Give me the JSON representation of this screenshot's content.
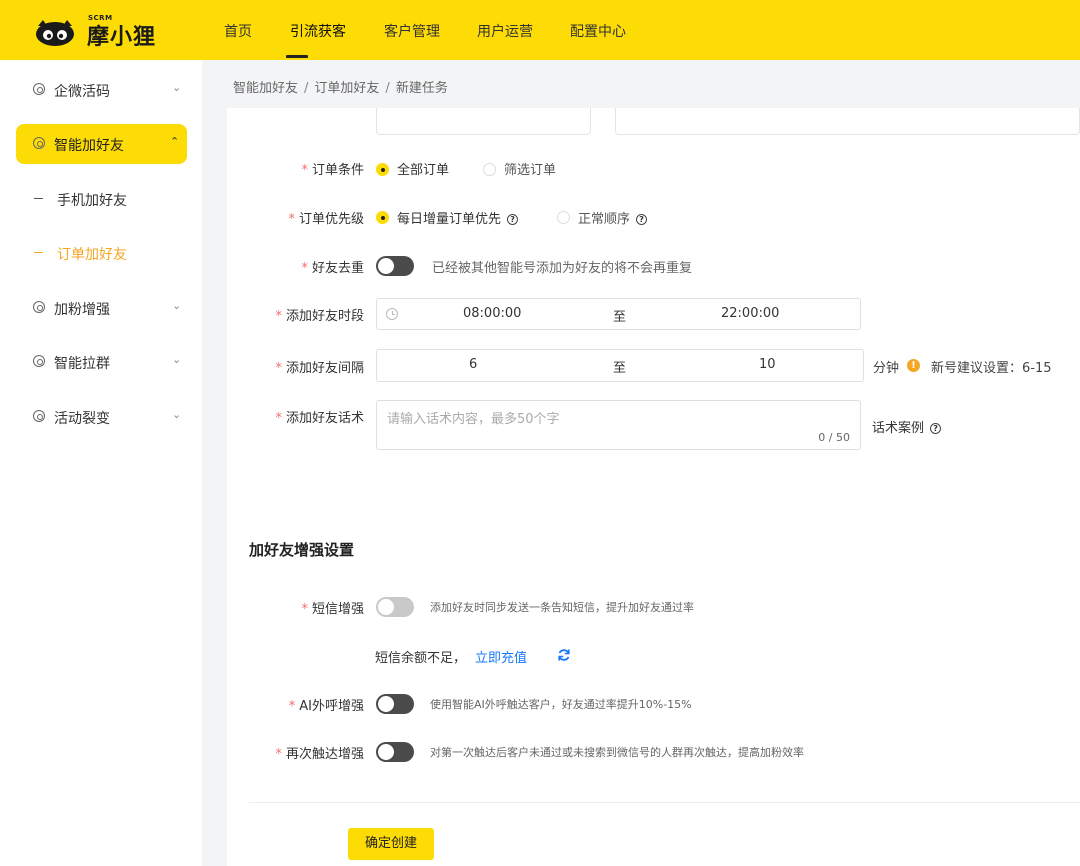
{
  "brand": {
    "scrm": "SCRM",
    "name": "摩小狸"
  },
  "nav": {
    "items": [
      "首页",
      "引流获客",
      "客户管理",
      "用户运营",
      "配置中心"
    ],
    "active_index": 1
  },
  "sidebar": {
    "items": [
      {
        "label": "企微活码",
        "icon": "qrcode-icon"
      },
      {
        "label": "智能加好友",
        "icon": "add-friend-icon"
      },
      {
        "label": "手机加好友",
        "icon": "dash"
      },
      {
        "label": "订单加好友",
        "icon": "dash"
      },
      {
        "label": "加粉增强",
        "icon": "boost-icon"
      },
      {
        "label": "智能拉群",
        "icon": "group-icon"
      },
      {
        "label": "活动裂变",
        "icon": "fission-icon"
      }
    ]
  },
  "breadcrumb": {
    "items": [
      "智能加好友",
      "订单加好友",
      "新建任务"
    ],
    "separator": "/"
  },
  "form": {
    "order_condition": {
      "label": "订单条件",
      "options": [
        "全部订单",
        "筛选订单"
      ],
      "selected": 0
    },
    "order_priority": {
      "label": "订单优先级",
      "options": [
        "每日增量订单优先",
        "正常顺序"
      ],
      "selected": 0
    },
    "dedupe": {
      "label": "好友去重",
      "hint": "已经被其他智能号添加为好友的将不会再重复"
    },
    "time_range": {
      "label": "添加好友时段",
      "start": "08:00:00",
      "separator": "至",
      "end": "22:00:00"
    },
    "interval": {
      "label": "添加好友间隔",
      "min": "6",
      "separator": "至",
      "max": "10",
      "unit": "分钟",
      "suggest": "新号建议设置：6-15"
    },
    "script": {
      "label": "添加好友话术",
      "placeholder": "请输入话术内容，最多50个字",
      "count": "0 / 50",
      "example": "话术案例"
    }
  },
  "enhance": {
    "title": "加好友增强设置",
    "sms": {
      "label": "短信增强",
      "hint": "添加好友时同步发送一条告知短信，提升加好友通过率",
      "balance": "短信余额不足，",
      "recharge": "立即充值"
    },
    "ai_call": {
      "label": "AI外呼增强",
      "hint": "使用智能AI外呼触达客户，好友通过率提升10%-15%"
    },
    "retouch": {
      "label": "再次触达增强",
      "hint": "对第一次触达后客户未通过或未搜索到微信号的人群再次触达，提高加粉效率"
    }
  },
  "submit": "确定创建",
  "colors": {
    "brand": "#fddb05",
    "accent": "#f5a623",
    "link": "#1677ff",
    "required": "#f56c6c"
  }
}
